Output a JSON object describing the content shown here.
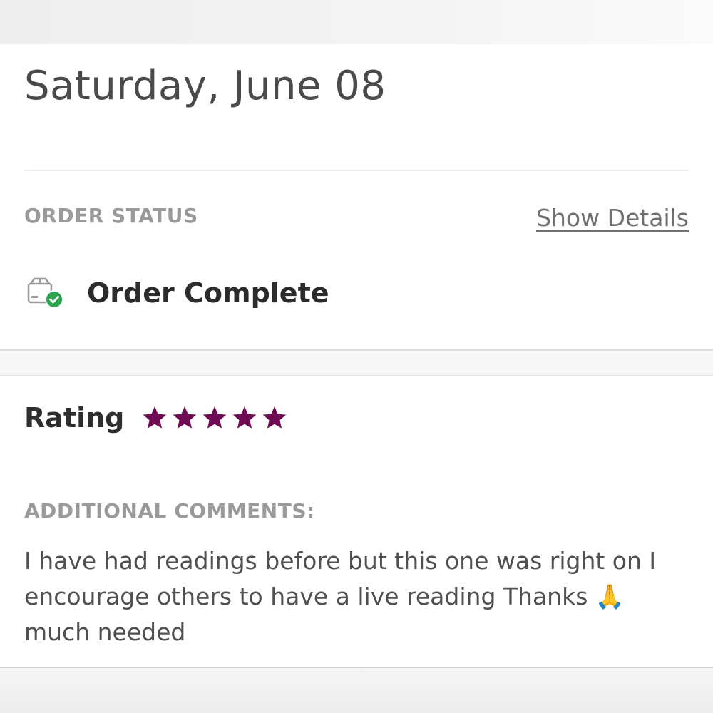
{
  "order": {
    "date": "Saturday, June 08",
    "status_label": "ORDER STATUS",
    "show_details_label": "Show Details",
    "status_text": "Order Complete",
    "status_icon": "package-check-icon",
    "status_color": "#2da44e"
  },
  "review": {
    "rating_label": "Rating",
    "rating_value": 5,
    "rating_max": 5,
    "star_color": "#6e0b52",
    "comments_label": "ADDITIONAL COMMENTS:",
    "comment_lines": [
      "I have had readings before but this one was right on I",
      "encourage others to have a live reading Thanks 🙏",
      "much needed"
    ]
  }
}
